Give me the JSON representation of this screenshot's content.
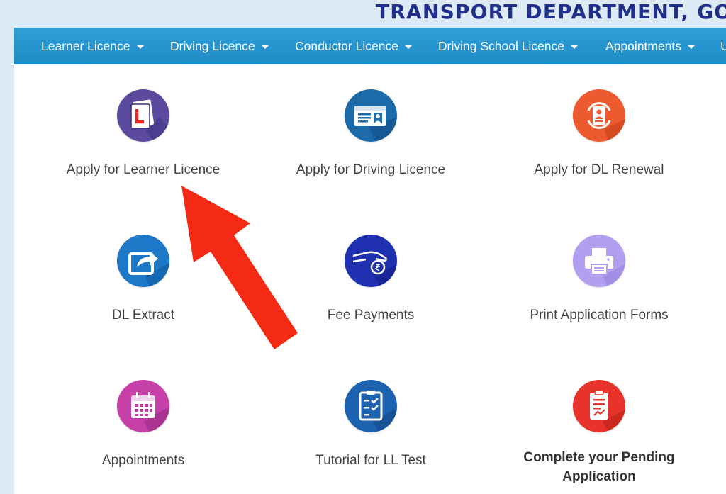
{
  "header": {
    "title": "TRANSPORT DEPARTMENT, GOVE"
  },
  "nav": {
    "items": [
      {
        "label": "Learner Licence"
      },
      {
        "label": "Driving Licence"
      },
      {
        "label": "Conductor Licence"
      },
      {
        "label": "Driving School Licence"
      },
      {
        "label": "Appointments"
      },
      {
        "label": "U"
      }
    ]
  },
  "tiles": [
    {
      "label": "Apply for Learner Licence",
      "icon": "learner-licence-icon",
      "color": "#5b4a9e"
    },
    {
      "label": "Apply for Driving Licence",
      "icon": "driving-licence-card-icon",
      "color": "#1c6aa8"
    },
    {
      "label": "Apply for DL Renewal",
      "icon": "dl-renewal-icon",
      "color": "#ee5a2f"
    },
    {
      "label": "DL Extract",
      "icon": "share-extract-icon",
      "color": "#1e78c8"
    },
    {
      "label": "Fee Payments",
      "icon": "fee-payment-icon",
      "color": "#1e2fb0"
    },
    {
      "label": "Print Application Forms",
      "icon": "printer-icon",
      "color": "#b39ff0"
    },
    {
      "label": "Appointments",
      "icon": "calendar-icon",
      "color": "#c640a8"
    },
    {
      "label": "Tutorial for LL Test",
      "icon": "clipboard-checklist-icon",
      "color": "#1d62b0"
    },
    {
      "label": "Complete your Pending Application",
      "icon": "pending-application-icon",
      "color": "#e8332a"
    }
  ],
  "annotation": {
    "arrow_color": "#f42a14"
  }
}
